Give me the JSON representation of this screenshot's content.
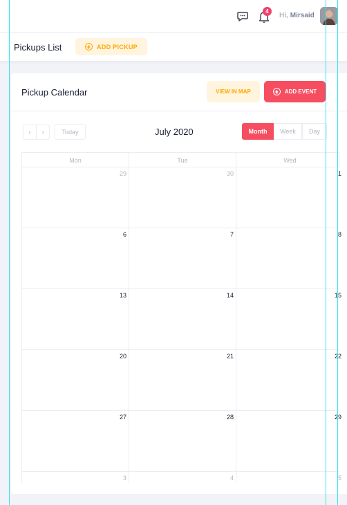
{
  "header": {
    "notifications_count": "4",
    "greeting": "Hi,",
    "user_name": "Mirsaid"
  },
  "subheader": {
    "title": "Pickups List",
    "add_pickup_label": "ADD PICKUP"
  },
  "card": {
    "title": "Pickup Calendar",
    "view_map_label": "VIEW IN MAP",
    "add_event_label": "ADD EVENT"
  },
  "calendar": {
    "prev_label": "‹",
    "next_label": "›",
    "today_label": "Today",
    "month_title": "July 2020",
    "views": [
      "Month",
      "Week",
      "Day"
    ],
    "active_view": "Month",
    "days_of_week": [
      "Mon",
      "Tue",
      "Wed"
    ],
    "weeks": [
      [
        {
          "n": "29",
          "other": true
        },
        {
          "n": "30",
          "other": true
        },
        {
          "n": "1",
          "other": false
        }
      ],
      [
        {
          "n": "6",
          "other": false
        },
        {
          "n": "7",
          "other": false
        },
        {
          "n": "8",
          "other": false
        }
      ],
      [
        {
          "n": "13",
          "other": false
        },
        {
          "n": "14",
          "other": false
        },
        {
          "n": "15",
          "other": false
        }
      ],
      [
        {
          "n": "20",
          "other": false
        },
        {
          "n": "21",
          "other": false
        },
        {
          "n": "22",
          "other": false
        }
      ],
      [
        {
          "n": "27",
          "other": false
        },
        {
          "n": "28",
          "other": false
        },
        {
          "n": "29",
          "other": false
        }
      ],
      [
        {
          "n": "3",
          "other": true
        },
        {
          "n": "4",
          "other": true
        },
        {
          "n": "5",
          "other": true
        }
      ]
    ]
  },
  "colors": {
    "accent_red": "#f64e60",
    "accent_warning": "#ffa800",
    "warning_light": "#fff4de",
    "guide_line": "#35e3ee"
  }
}
